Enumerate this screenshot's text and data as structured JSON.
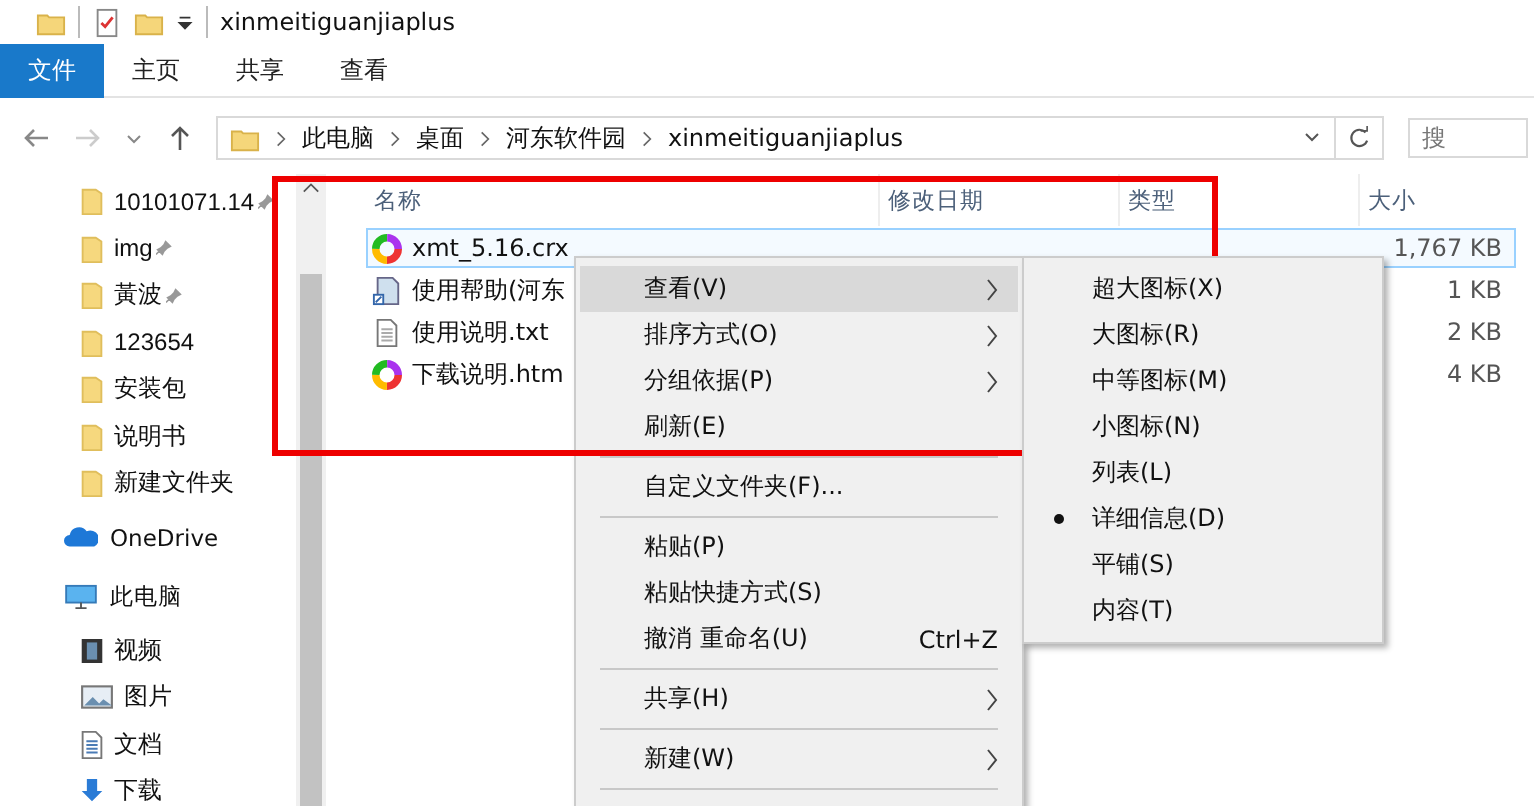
{
  "window": {
    "title": "xinmeitiguanjiaplus"
  },
  "ribbon": {
    "file_tab": "文件",
    "tabs": [
      "主页",
      "共享",
      "查看"
    ]
  },
  "address_bar": {
    "path": [
      "此电脑",
      "桌面",
      "河东软件园",
      "xinmeitiguanjiaplus"
    ]
  },
  "search": {
    "placeholder": "搜"
  },
  "nav": [
    {
      "label": "10101071.14",
      "kind": "folder",
      "pinned": true
    },
    {
      "label": "img",
      "kind": "folder",
      "pinned": true
    },
    {
      "label": "黃波",
      "kind": "folder",
      "pinned": true
    },
    {
      "label": "123654",
      "kind": "folder",
      "pinned": false
    },
    {
      "label": "安装包",
      "kind": "folder",
      "pinned": false
    },
    {
      "label": "说明书",
      "kind": "folder",
      "pinned": false
    },
    {
      "label": "新建文件夹",
      "kind": "folder",
      "pinned": false
    },
    {
      "label": "OneDrive",
      "kind": "cloud",
      "pinned": false
    },
    {
      "label": "此电脑",
      "kind": "pc",
      "pinned": false
    },
    {
      "label": "视频",
      "kind": "video",
      "pinned": false
    },
    {
      "label": "图片",
      "kind": "picture",
      "pinned": false
    },
    {
      "label": "文档",
      "kind": "document",
      "pinned": false
    },
    {
      "label": "下载",
      "kind": "download",
      "pinned": false
    }
  ],
  "columns": [
    "名称",
    "修改日期",
    "类型",
    "大小"
  ],
  "files": [
    {
      "name": "xmt_5.16.crx",
      "kind": "chrome",
      "size": "1,767 KB",
      "selected": true
    },
    {
      "name": "使用帮助(河东",
      "kind": "shortcut",
      "size": "1 KB",
      "selected": false
    },
    {
      "name": "使用说明.txt",
      "kind": "text",
      "size": "2 KB",
      "selected": false
    },
    {
      "name": "下载说明.htm",
      "kind": "chrome",
      "size": "4 KB",
      "selected": false
    }
  ],
  "context_menu": [
    {
      "kind": "item",
      "label": "查看(V)",
      "submenu": true,
      "highlighted": true
    },
    {
      "kind": "item",
      "label": "排序方式(O)",
      "submenu": true,
      "highlighted": false
    },
    {
      "kind": "item",
      "label": "分组依据(P)",
      "submenu": true,
      "highlighted": false
    },
    {
      "kind": "item",
      "label": "刷新(E)",
      "submenu": false,
      "highlighted": false
    },
    {
      "kind": "separator"
    },
    {
      "kind": "item",
      "label": "自定义文件夹(F)...",
      "submenu": false,
      "highlighted": false
    },
    {
      "kind": "separator"
    },
    {
      "kind": "item",
      "label": "粘贴(P)",
      "submenu": false,
      "highlighted": false
    },
    {
      "kind": "item",
      "label": "粘贴快捷方式(S)",
      "submenu": false,
      "highlighted": false
    },
    {
      "kind": "item",
      "label": "撤消 重命名(U)",
      "shortcut": "Ctrl+Z",
      "submenu": false,
      "highlighted": false
    },
    {
      "kind": "separator"
    },
    {
      "kind": "item",
      "label": "共享(H)",
      "submenu": true,
      "highlighted": false
    },
    {
      "kind": "separator"
    },
    {
      "kind": "item",
      "label": "新建(W)",
      "submenu": true,
      "highlighted": false
    },
    {
      "kind": "separator"
    }
  ],
  "view_submenu": [
    {
      "label": "超大图标(X)",
      "selected": false
    },
    {
      "label": "大图标(R)",
      "selected": false
    },
    {
      "label": "中等图标(M)",
      "selected": false
    },
    {
      "label": "小图标(N)",
      "selected": false
    },
    {
      "label": "列表(L)",
      "selected": false
    },
    {
      "label": "详细信息(D)",
      "selected": true
    },
    {
      "label": "平铺(S)",
      "selected": false
    },
    {
      "label": "内容(T)",
      "selected": false
    }
  ]
}
